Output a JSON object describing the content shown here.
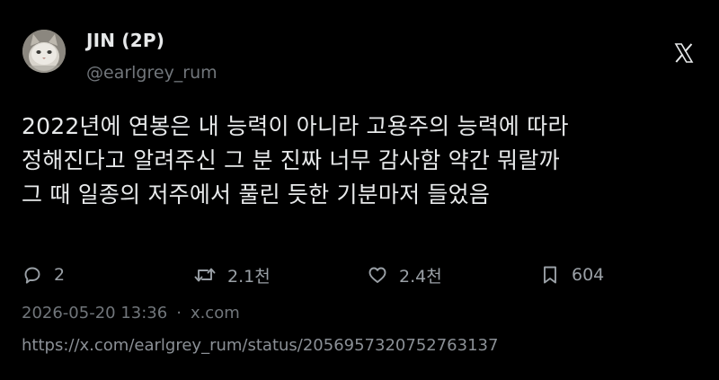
{
  "author": {
    "name": "JIN (2P)",
    "handle": "@earlgrey_rum",
    "avatar_icon": "cat-avatar-photo"
  },
  "platform_icon": "x-logo-icon",
  "tweet": {
    "lines": [
      "2022년에 연봉은 내 능력이 아니라 고용주의 능력에 따라",
      "정해진다고 알려주신 그 분 진짜 너무 감사함 약간 뭐랄까",
      "그 때 일종의 저주에서 풀린 듯한 기분마저 들었음"
    ]
  },
  "actions": {
    "reply": {
      "icon": "reply-bubble-icon",
      "count": "2"
    },
    "repost": {
      "icon": "repost-icon",
      "count": "2.1천"
    },
    "like": {
      "icon": "heart-icon",
      "count": "2.4천"
    },
    "bookmark": {
      "icon": "bookmark-icon",
      "count": "604"
    }
  },
  "meta": {
    "timestamp": "2026-05-20 13:36",
    "separator": "·",
    "source": "x.com"
  },
  "url": "https://x.com/earlgrey_rum/status/2056957320752763137",
  "colors": {
    "background": "#000000",
    "text_primary": "#e7e9ea",
    "text_secondary": "#71767b"
  }
}
